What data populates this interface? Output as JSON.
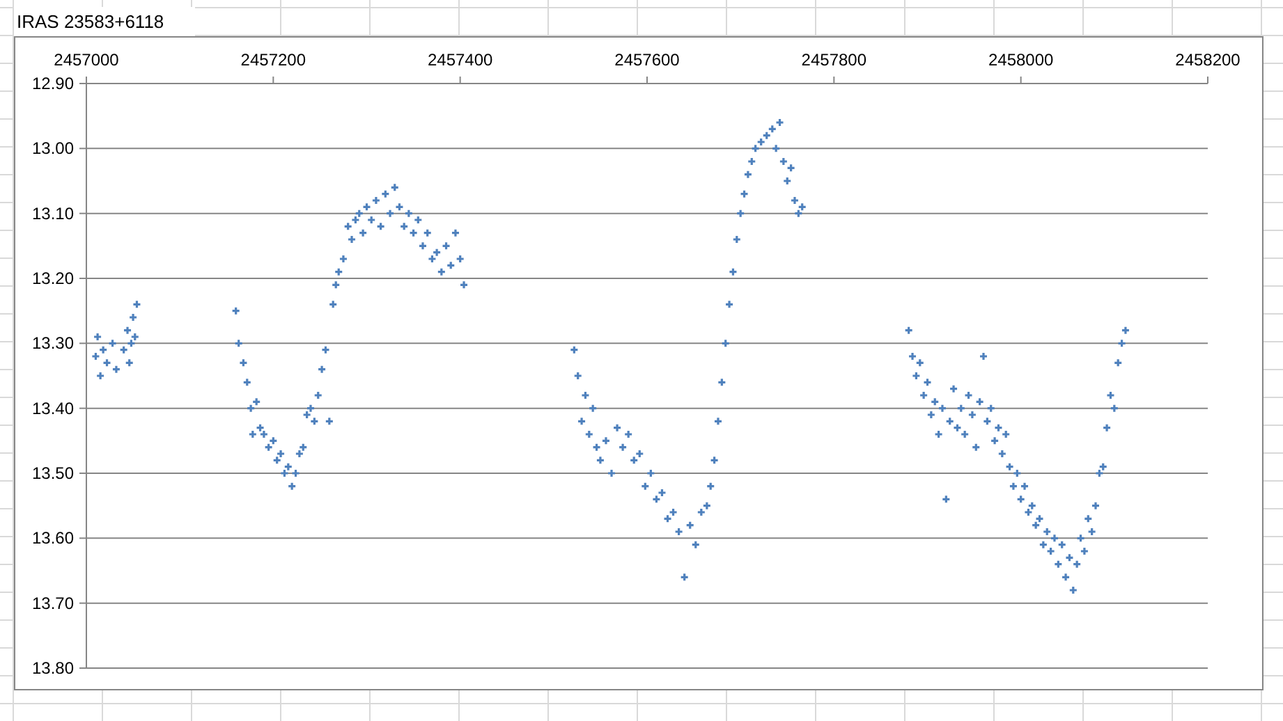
{
  "title": "IRAS 23583+6118",
  "chart": {
    "chart_data": {
      "type": "scatter",
      "xlim": [
        2457000,
        2458200
      ],
      "ylim": [
        13.8,
        12.9
      ],
      "grid": true,
      "xticks": [
        2457000,
        2457200,
        2457400,
        2457600,
        2457800,
        2458000,
        2458200
      ],
      "yticks": [
        {
          "value": 12.9,
          "label": "12.90"
        },
        {
          "value": 13.0,
          "label": "13.00"
        },
        {
          "value": 13.1,
          "label": "13.10"
        },
        {
          "value": 13.2,
          "label": "13.20"
        },
        {
          "value": 13.3,
          "label": "13.30"
        },
        {
          "value": 13.4,
          "label": "13.40"
        },
        {
          "value": 13.5,
          "label": "13.50"
        },
        {
          "value": 13.6,
          "label": "13.60"
        },
        {
          "value": 13.7,
          "label": "13.70"
        },
        {
          "value": 13.8,
          "label": "13.80"
        }
      ],
      "x": [
        2457010,
        2457012,
        2457015,
        2457018,
        2457022,
        2457028,
        2457032,
        2457040,
        2457044,
        2457046,
        2457048,
        2457050,
        2457052,
        2457054,
        2457160,
        2457163,
        2457168,
        2457172,
        2457176,
        2457178,
        2457182,
        2457186,
        2457190,
        2457195,
        2457200,
        2457204,
        2457208,
        2457212,
        2457216,
        2457220,
        2457224,
        2457228,
        2457232,
        2457236,
        2457240,
        2457244,
        2457248,
        2457252,
        2457256,
        2457260,
        2457264,
        2457267,
        2457270,
        2457275,
        2457280,
        2457284,
        2457288,
        2457292,
        2457296,
        2457300,
        2457305,
        2457310,
        2457315,
        2457320,
        2457325,
        2457330,
        2457335,
        2457340,
        2457345,
        2457350,
        2457355,
        2457360,
        2457365,
        2457370,
        2457375,
        2457380,
        2457385,
        2457390,
        2457395,
        2457400,
        2457404,
        2457522,
        2457526,
        2457530,
        2457534,
        2457538,
        2457542,
        2457546,
        2457550,
        2457556,
        2457562,
        2457568,
        2457574,
        2457580,
        2457586,
        2457592,
        2457598,
        2457604,
        2457610,
        2457616,
        2457622,
        2457628,
        2457634,
        2457640,
        2457646,
        2457652,
        2457658,
        2457664,
        2457668,
        2457672,
        2457676,
        2457680,
        2457684,
        2457688,
        2457692,
        2457696,
        2457700,
        2457704,
        2457708,
        2457712,
        2457716,
        2457722,
        2457728,
        2457734,
        2457738,
        2457742,
        2457746,
        2457750,
        2457754,
        2457758,
        2457762,
        2457766,
        2457880,
        2457884,
        2457888,
        2457892,
        2457896,
        2457900,
        2457904,
        2457908,
        2457912,
        2457916,
        2457920,
        2457924,
        2457928,
        2457932,
        2457936,
        2457940,
        2457944,
        2457948,
        2457952,
        2457956,
        2457960,
        2457964,
        2457968,
        2457972,
        2457976,
        2457980,
        2457984,
        2457988,
        2457992,
        2457996,
        2458000,
        2458004,
        2458008,
        2458012,
        2458016,
        2458020,
        2458024,
        2458028,
        2458032,
        2458036,
        2458040,
        2458044,
        2458048,
        2458052,
        2458056,
        2458060,
        2458064,
        2458068,
        2458072,
        2458076,
        2458080,
        2458084,
        2458088,
        2458092,
        2458096,
        2458100,
        2458104,
        2458108,
        2458112
      ],
      "series": [
        {
          "color": "#4f81bd",
          "values": [
            13.32,
            13.29,
            13.35,
            13.31,
            13.33,
            13.3,
            13.34,
            13.31,
            13.28,
            13.33,
            13.3,
            13.26,
            13.29,
            13.24,
            13.25,
            13.3,
            13.33,
            13.36,
            13.4,
            13.44,
            13.39,
            13.43,
            13.44,
            13.46,
            13.45,
            13.48,
            13.47,
            13.5,
            13.49,
            13.52,
            13.5,
            13.47,
            13.46,
            13.41,
            13.4,
            13.42,
            13.38,
            13.34,
            13.31,
            13.42,
            13.24,
            13.21,
            13.19,
            13.17,
            13.12,
            13.14,
            13.11,
            13.1,
            13.13,
            13.09,
            13.11,
            13.08,
            13.12,
            13.07,
            13.1,
            13.06,
            13.09,
            13.12,
            13.1,
            13.13,
            13.11,
            13.15,
            13.13,
            13.17,
            13.16,
            13.19,
            13.15,
            13.18,
            13.13,
            13.17,
            13.21,
            13.31,
            13.35,
            13.42,
            13.38,
            13.44,
            13.4,
            13.46,
            13.48,
            13.45,
            13.5,
            13.43,
            13.46,
            13.44,
            13.48,
            13.47,
            13.52,
            13.5,
            13.54,
            13.53,
            13.57,
            13.56,
            13.59,
            13.66,
            13.58,
            13.61,
            13.56,
            13.55,
            13.52,
            13.48,
            13.42,
            13.36,
            13.3,
            13.24,
            13.19,
            13.14,
            13.1,
            13.07,
            13.04,
            13.02,
            13.0,
            12.99,
            12.98,
            12.97,
            13.0,
            12.96,
            13.02,
            13.05,
            13.03,
            13.08,
            13.1,
            13.09,
            13.28,
            13.32,
            13.35,
            13.33,
            13.38,
            13.36,
            13.41,
            13.39,
            13.44,
            13.4,
            13.54,
            13.42,
            13.37,
            13.43,
            13.4,
            13.44,
            13.38,
            13.41,
            13.46,
            13.39,
            13.32,
            13.42,
            13.4,
            13.45,
            13.43,
            13.47,
            13.44,
            13.49,
            13.52,
            13.5,
            13.54,
            13.52,
            13.56,
            13.55,
            13.58,
            13.57,
            13.61,
            13.59,
            13.62,
            13.6,
            13.64,
            13.61,
            13.66,
            13.63,
            13.68,
            13.64,
            13.6,
            13.62,
            13.57,
            13.59,
            13.55,
            13.5,
            13.49,
            13.43,
            13.38,
            13.4,
            13.33,
            13.3,
            13.28
          ]
        }
      ]
    }
  }
}
